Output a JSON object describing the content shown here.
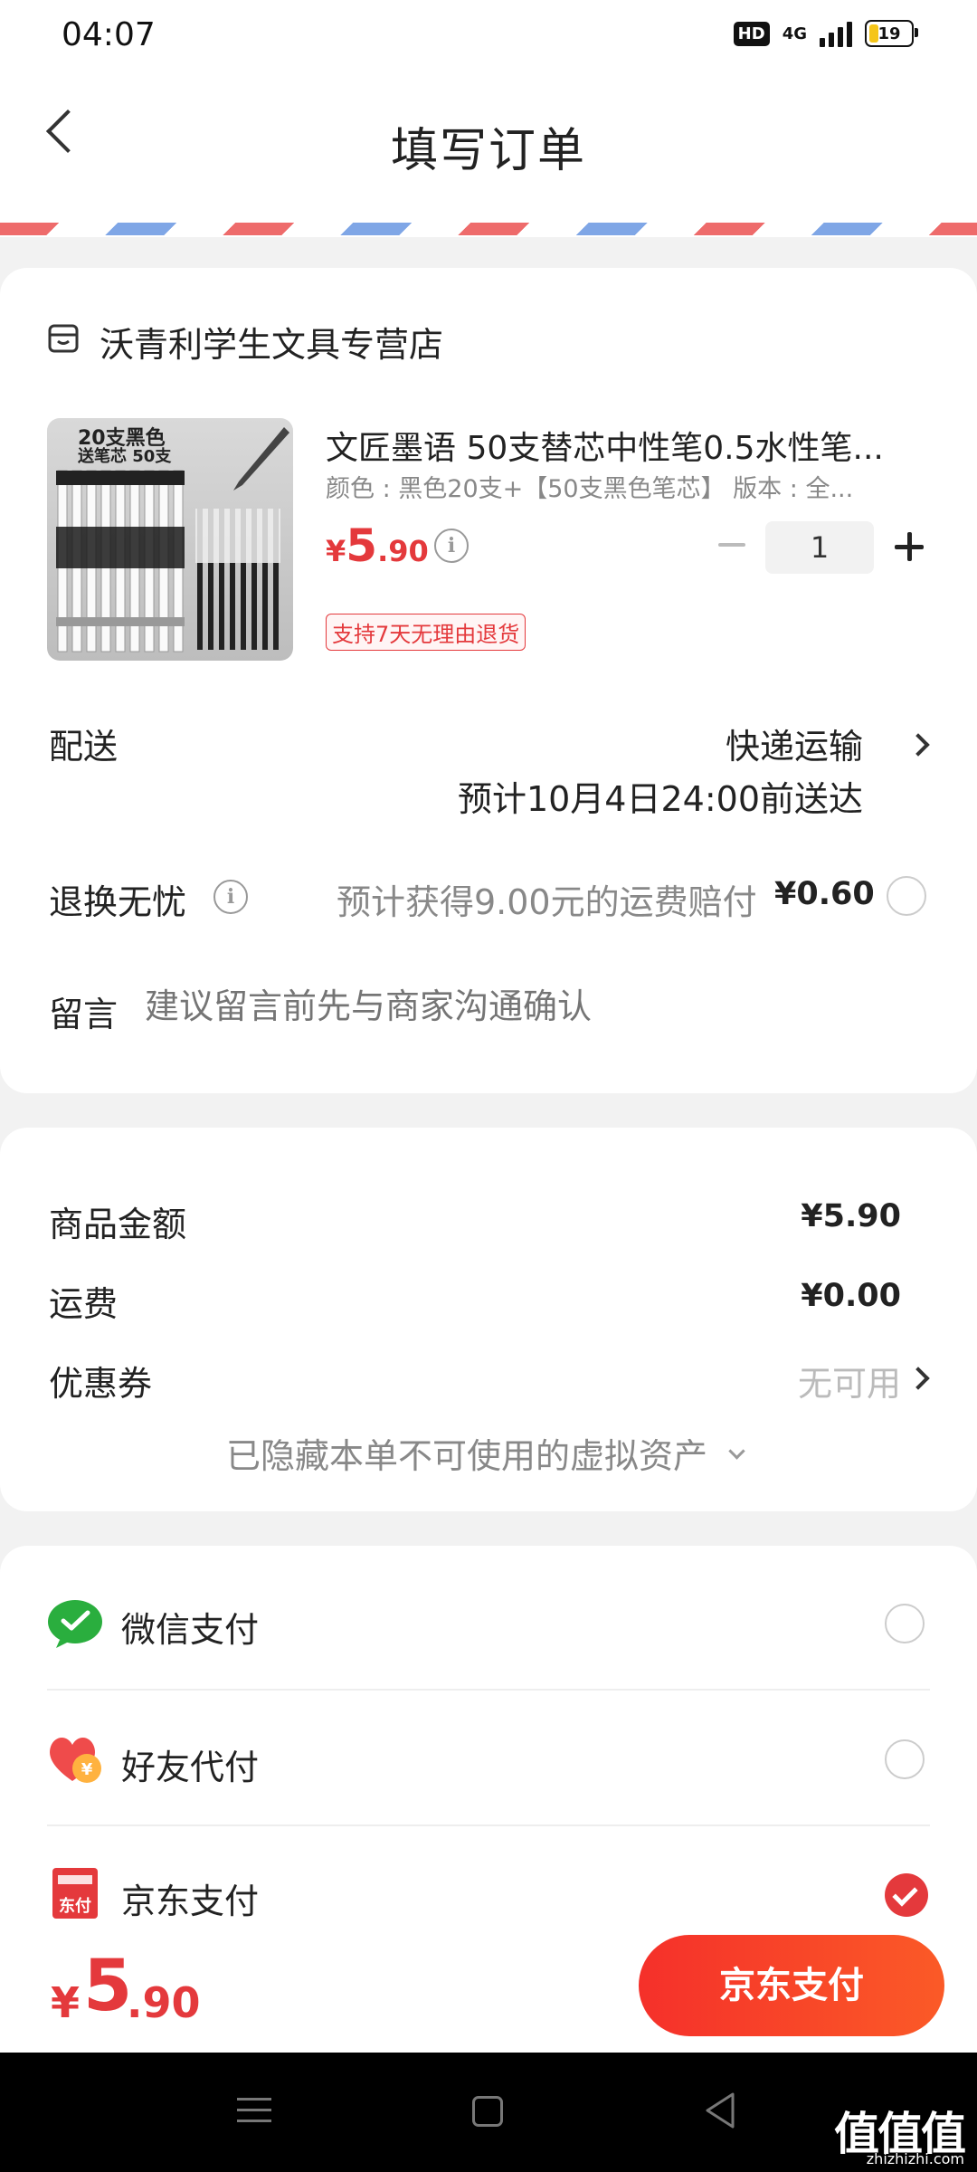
{
  "status_bar": {
    "time": "04:07",
    "hd": "HD",
    "network": "4G",
    "battery": "19"
  },
  "header": {
    "title": "填写订单",
    "back_icon": "chevron-left-icon"
  },
  "store": {
    "icon": "store-icon",
    "name": "沃青利学生文具专营店"
  },
  "product": {
    "image_caption_1": "20支黑色",
    "image_caption_2": "送笔芯 50支",
    "title": "文匠墨语 50支替芯中性笔0.5水性笔...",
    "spec": "颜色 : 黑色20支+【50支黑色笔芯】  版本 : 全...",
    "price_symbol": "¥",
    "price_int": "5",
    "price_dec": ".90",
    "quantity": "1",
    "return_badge": "支持7天无理由退货"
  },
  "delivery": {
    "label": "配送",
    "method": "快递运输",
    "estimate": "预计10月4日24:00前送达"
  },
  "insurance": {
    "label": "退换无忧",
    "description": "预计获得9.00元的运费赔付",
    "price": "¥0.60"
  },
  "message": {
    "label": "留言",
    "placeholder": "建议留言前先与商家沟通确认"
  },
  "summary": {
    "goods_label": "商品金额",
    "goods_value": "¥5.90",
    "shipping_label": "运费",
    "shipping_value": "¥0.00",
    "coupon_label": "优惠券",
    "coupon_value": "无可用",
    "hidden_assets": "已隐藏本单不可使用的虚拟资产",
    "hidden_assets_icon": "chevron-down-icon"
  },
  "payment": {
    "options": [
      {
        "label": "微信支付",
        "icon": "wechat-pay-icon",
        "selected": false
      },
      {
        "label": "好友代付",
        "icon": "friend-pay-icon",
        "selected": false
      },
      {
        "label": "京东支付",
        "icon": "jd-pay-icon",
        "selected": true
      }
    ],
    "jd_icon_text": "东付"
  },
  "bottom": {
    "total_symbol": "¥",
    "total_int": "5",
    "total_dec": ".90",
    "pay_button": "京东支付"
  },
  "watermark": {
    "text": "值值值",
    "url": "zhizhizhi.com"
  },
  "colors": {
    "accent": "#e4393c",
    "pay_button_from": "#f5302a",
    "pay_button_to": "#fb5a27",
    "wechat_green": "#2aae3e"
  }
}
